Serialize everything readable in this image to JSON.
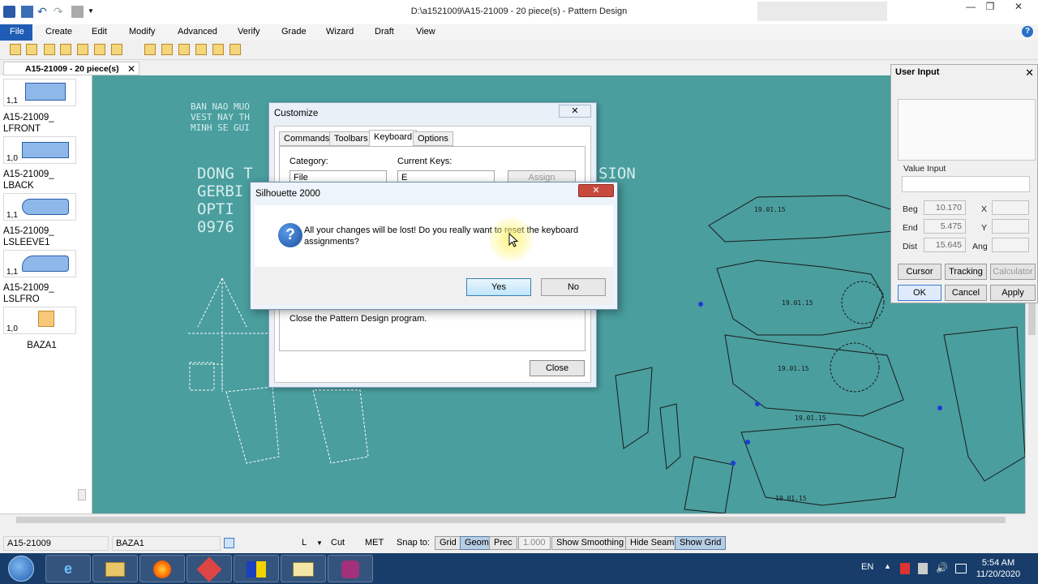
{
  "window": {
    "title": "D:\\a1521009\\A15-21009 - 20 piece(s) - Pattern Design",
    "min_label": "—",
    "max_label": "❐",
    "close_label": "✕"
  },
  "menu": {
    "items": [
      "File",
      "Create",
      "Edit",
      "Modify",
      "Advanced",
      "Verify",
      "Grade",
      "Wizard",
      "Draft",
      "View"
    ],
    "help_label": "?"
  },
  "doc_tab": {
    "label": "A15-21009 - 20 piece(s)",
    "close_label": "✕"
  },
  "pieces": [
    {
      "name": "",
      "scale": "1,1"
    },
    {
      "name": "A15-21009_ LFRONT",
      "scale": "1,0"
    },
    {
      "name": "A15-21009_ LBACK",
      "scale": "1,1"
    },
    {
      "name": "A15-21009_ LSLEEVE1",
      "scale": "1,1"
    },
    {
      "name": "A15-21009_ LSLFRO",
      "scale": "1,0"
    },
    {
      "name": "BAZA1",
      "scale": ""
    }
  ],
  "canvas": {
    "note_small": "BAN NAO MUO\nVEST NAY TH\nMINH SE GUI",
    "note_large": "DONG T\nGERBI\nOPTI\n0976",
    "note_right": "SION",
    "piece_labels": [
      "19.01.15",
      "19.01.15",
      "19.01.15",
      "19.01.15",
      "19.01.15"
    ],
    "colors": {
      "background": "#4a9e9e",
      "lines": "#1a1a1a",
      "white_lines": "#ffffff"
    }
  },
  "user_input": {
    "title": "User Input",
    "close_label": "✕",
    "value_input_label": "Value Input",
    "fields": [
      {
        "label": "Beg",
        "value": "10.170",
        "axis": "X"
      },
      {
        "label": "End",
        "value": "5.475",
        "axis": "Y"
      },
      {
        "label": "Dist",
        "value": "15.645",
        "axis": "Ang"
      }
    ],
    "buttons": {
      "cursor": "Cursor",
      "tracking": "Tracking",
      "calculator": "Calculator",
      "ok": "OK",
      "cancel": "Cancel",
      "apply": "Apply"
    }
  },
  "customize": {
    "title": "Customize",
    "close_label": "✕",
    "tabs": [
      "Commands",
      "Toolbars",
      "Keyboard",
      "Options"
    ],
    "active_tab": "Keyboard",
    "category_label": "Category:",
    "category_value": "File",
    "current_keys_label": "Current Keys:",
    "current_keys_value": "E",
    "assign_label": "Assign",
    "description": "Close the Pattern Design program.",
    "close_button": "Close"
  },
  "message_box": {
    "title": "Silhouette 2000",
    "close_label": "✕",
    "icon": "question-icon",
    "message": "All your changes will be lost! Do you really want to reset the keyboard assignments?",
    "yes_label": "Yes",
    "no_label": "No"
  },
  "status_bar": {
    "file": "A15-21009",
    "piece": "BAZA1",
    "layer": "L",
    "cut": "Cut",
    "units": "MET",
    "snap_label": "Snap to:",
    "buttons": [
      "Grid",
      "Geom",
      "Prec",
      "1.000",
      "Show Smoothing",
      "Hide Seams",
      "Show Grid"
    ],
    "active_buttons": [
      "Geom",
      "Show Grid"
    ]
  },
  "taskbar": {
    "language": "EN",
    "time": "5:54 AM",
    "date": "11/20/2020",
    "apps": [
      "start-orb",
      "ie-icon",
      "explorer-icon",
      "firefox-icon",
      "pattern-app-icon",
      "gerber-icon",
      "folder-icon",
      "video-app-icon"
    ]
  }
}
